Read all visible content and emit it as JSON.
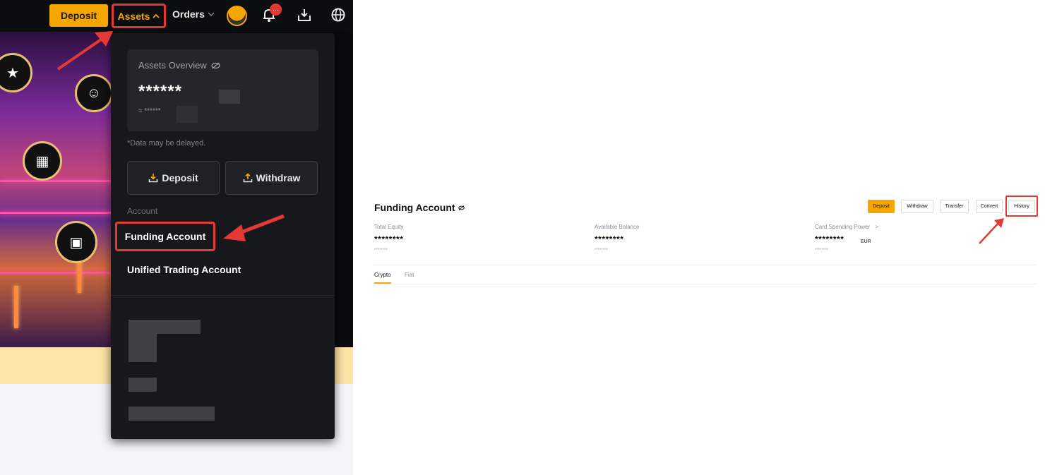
{
  "left_panel": {
    "topbar": {
      "deposit_label": "Deposit",
      "assets_label": "Assets",
      "assets_chevron": "^",
      "orders_label": "Orders",
      "orders_chevron": "⌄",
      "notification_badge": "···"
    },
    "dropdown": {
      "overview_title": "Assets Overview",
      "overview_balance": "******",
      "overview_approx": "≈ ******",
      "delay_note": "*Data may be delayed.",
      "deposit_label": "Deposit",
      "withdraw_label": "Withdraw",
      "account_section_label": "Account",
      "funding_account_label": "Funding Account",
      "unified_account_label": "Unified Trading Account"
    }
  },
  "right_panel": {
    "title": "Funding Account",
    "buttons": [
      "Deposit",
      "Withdraw",
      "Transfer",
      "Convert",
      "History"
    ],
    "metrics": [
      {
        "label": "Total Equity",
        "value": "********",
        "sub": "********"
      },
      {
        "label": "Available Balance",
        "value": "********",
        "sub": "********"
      },
      {
        "label": "Card Spending Power",
        "value": "********",
        "unit": "EUR",
        "sub": "********",
        "chevron": ">"
      }
    ],
    "tabs": [
      "Crypto",
      "Fiat"
    ]
  },
  "colors": {
    "accent": "#f7a600",
    "highlight": "#e53935",
    "dark_bg": "#17181c"
  }
}
